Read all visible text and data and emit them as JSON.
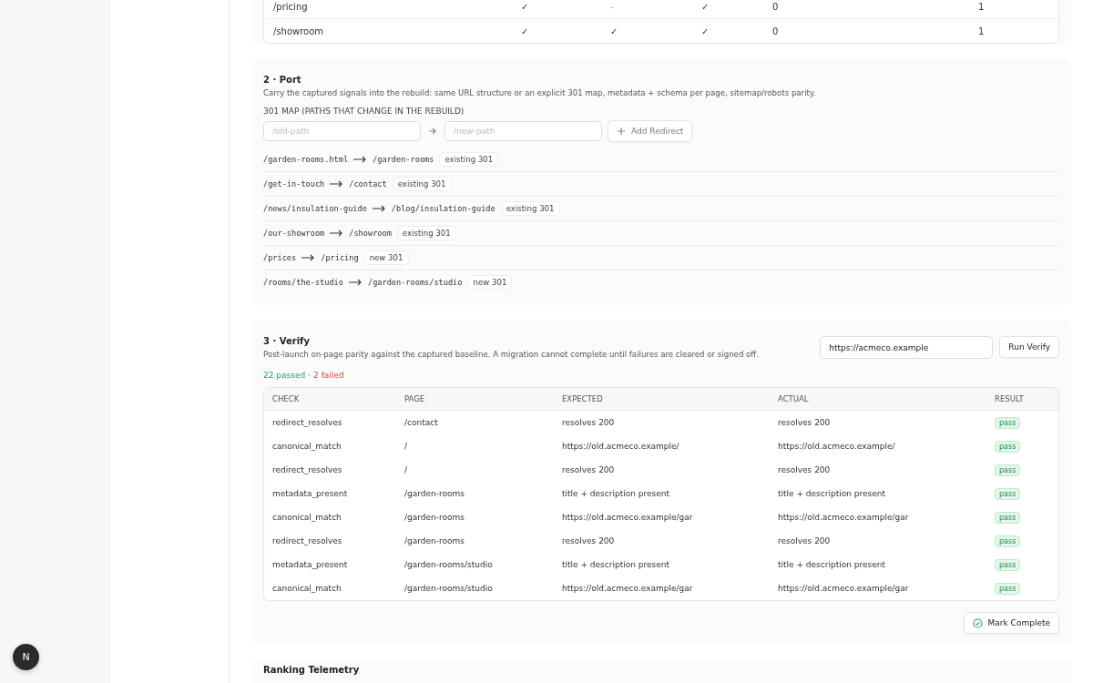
{
  "signals_table": {
    "rows": [
      {
        "path": "/pricing",
        "cells": [
          {
            "kind": "check",
            "text": "✓"
          },
          {
            "kind": "dash",
            "text": "-"
          },
          {
            "kind": "check",
            "text": "✓"
          },
          {
            "kind": "text",
            "text": "0"
          },
          {
            "kind": "text",
            "text": "1"
          }
        ]
      },
      {
        "path": "/showroom",
        "cells": [
          {
            "kind": "check",
            "text": "✓"
          },
          {
            "kind": "check",
            "text": "✓"
          },
          {
            "kind": "check",
            "text": "✓"
          },
          {
            "kind": "text",
            "text": "0"
          },
          {
            "kind": "text",
            "text": "1"
          }
        ]
      }
    ]
  },
  "port": {
    "title": "2 · Port",
    "description": "Carry the captured signals into the rebuild: same URL structure or an explicit 301 map, metadata + schema per page, sitemap/robots parity.",
    "map_label": "301 MAP (PATHS THAT CHANGE IN THE REBUILD)",
    "old_placeholder": "/old-path",
    "new_placeholder": "/new-path",
    "add_button": "Add Redirect",
    "redirects": [
      {
        "from": "/garden-rooms.html",
        "to": "/garden-rooms",
        "tag": "existing 301"
      },
      {
        "from": "/get-in-touch",
        "to": "/contact",
        "tag": "existing 301"
      },
      {
        "from": "/news/insulation-guide",
        "to": "/blog/insulation-guide",
        "tag": "existing 301"
      },
      {
        "from": "/our-showroom",
        "to": "/showroom",
        "tag": "existing 301"
      },
      {
        "from": "/prices",
        "to": "/pricing",
        "tag": "new 301"
      },
      {
        "from": "/rooms/the-studio",
        "to": "/garden-rooms/studio",
        "tag": "new 301"
      }
    ]
  },
  "verify": {
    "title": "3 · Verify",
    "description": "Post-launch on-page parity against the captured baseline. A migration cannot complete until failures are cleared or signed off.",
    "url": "https://acmeco.example",
    "run_button": "Run Verify",
    "passed": "22 passed",
    "separator": "·",
    "failed": "2 failed",
    "columns": [
      "CHECK",
      "PAGE",
      "EXPECTED",
      "ACTUAL",
      "RESULT"
    ],
    "rows": [
      {
        "check": "redirect_resolves",
        "page": "/contact",
        "expected": "resolves 200",
        "actual": "resolves 200",
        "result": "pass"
      },
      {
        "check": "canonical_match",
        "page": "/",
        "expected": "https://old.acmeco.example/",
        "actual": "https://old.acmeco.example/",
        "result": "pass"
      },
      {
        "check": "redirect_resolves",
        "page": "/",
        "expected": "resolves 200",
        "actual": "resolves 200",
        "result": "pass"
      },
      {
        "check": "metadata_present",
        "page": "/garden-rooms",
        "expected": "title + description present",
        "actual": "title + description present",
        "result": "pass"
      },
      {
        "check": "canonical_match",
        "page": "/garden-rooms",
        "expected": "https://old.acmeco.example/gar",
        "actual": "https://old.acmeco.example/gar",
        "result": "pass"
      },
      {
        "check": "redirect_resolves",
        "page": "/garden-rooms",
        "expected": "resolves 200",
        "actual": "resolves 200",
        "result": "pass"
      },
      {
        "check": "metadata_present",
        "page": "/garden-rooms/studio",
        "expected": "title + description present",
        "actual": "title + description present",
        "result": "pass"
      },
      {
        "check": "canonical_match",
        "page": "/garden-rooms/studio",
        "expected": "https://old.acmeco.example/gar",
        "actual": "https://old.acmeco.example/gar",
        "result": "pass"
      }
    ],
    "complete_button": "Mark Complete"
  },
  "next_section": {
    "title": "Ranking Telemetry"
  },
  "dev_badge": {
    "letter": "N"
  }
}
